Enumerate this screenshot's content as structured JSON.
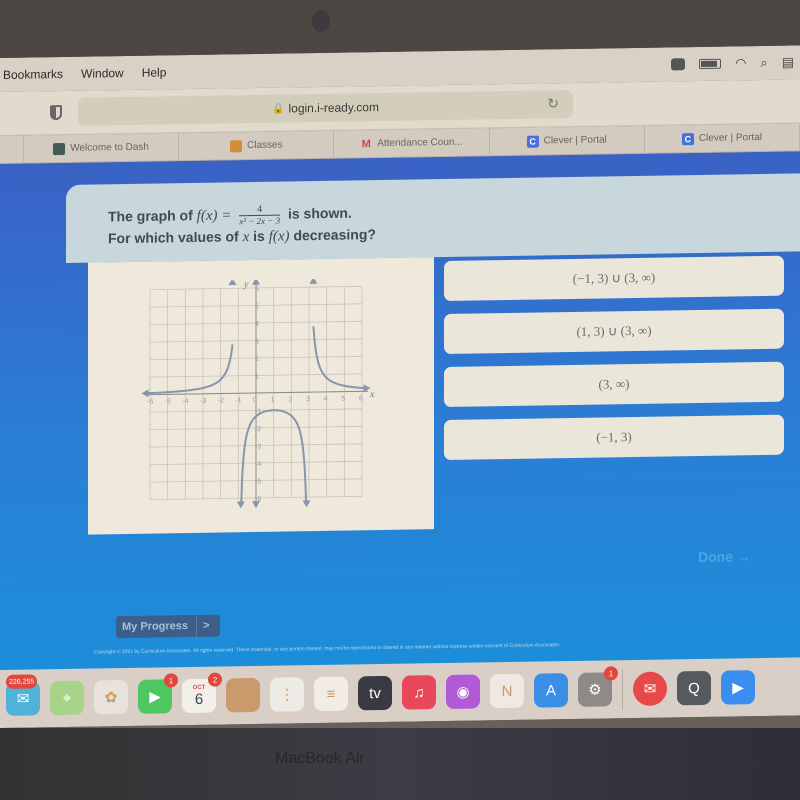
{
  "menubar": {
    "items": [
      "Bookmarks",
      "Window",
      "Help"
    ],
    "status_icons": [
      "camera-icon",
      "battery-icon",
      "wifi-icon",
      "search-icon",
      "control-center-icon"
    ]
  },
  "browser": {
    "url": "login.i-ready.com",
    "tabs": [
      {
        "label": "",
        "icon": "none"
      },
      {
        "label": "Welcome to Dash",
        "icon": "dash-icon"
      },
      {
        "label": "Classes",
        "icon": "classes-icon"
      },
      {
        "label": "Attendance Coun...",
        "icon": "gmail-icon"
      },
      {
        "label": "Clever | Portal",
        "icon": "clever-icon"
      },
      {
        "label": "Clever | Portal",
        "icon": "clever-icon"
      }
    ]
  },
  "question": {
    "prefix": "The graph of ",
    "function_lhs": "f(x) =",
    "numerator": "4",
    "denominator": "x² − 2x − 3",
    "suffix": " is shown.",
    "line2_a": "For which values of ",
    "var_x": "x",
    "line2_b": " is ",
    "fx": "f(x)",
    "line2_c": " decreasing?"
  },
  "answers": [
    "(−1, 3) ∪ (3, ∞)",
    "(1, 3) ∪ (3, ∞)",
    "(3, ∞)",
    "(−1, 3)"
  ],
  "buttons": {
    "done": "Done →",
    "my_progress": "My Progress",
    "my_progress_chevron": ">"
  },
  "footer": {
    "copyright": "Copyright © 2021 by Curriculum Associates. All rights reserved. These materials, or any portion thereof, may not be reproduced or shared in any manner without express written consent of Curriculum Associates."
  },
  "dock": {
    "apps": [
      {
        "name": "mail-app",
        "badge": "226,255",
        "color": "#4fb3d9"
      },
      {
        "name": "maps-app",
        "badge": "",
        "color": "#a8d48a"
      },
      {
        "name": "photos-app",
        "badge": "",
        "color": "#e8e2dc"
      },
      {
        "name": "facetime-app",
        "badge": "1",
        "color": "#4ec761"
      },
      {
        "name": "calendar-app",
        "badge": "2",
        "color": "#f2eee9",
        "month": "OCT",
        "day": "6"
      },
      {
        "name": "contacts-app",
        "badge": "",
        "color": "#c99a6b"
      },
      {
        "name": "reminders-app",
        "badge": "",
        "color": "#eeeae6"
      },
      {
        "name": "notes-app",
        "badge": "",
        "color": "#f2ede4"
      },
      {
        "name": "tv-app",
        "badge": "",
        "color": "#3a3a42",
        "label": "tv"
      },
      {
        "name": "music-app",
        "badge": "",
        "color": "#e8485a"
      },
      {
        "name": "podcasts-app",
        "badge": "",
        "color": "#b15ad6"
      },
      {
        "name": "news-app",
        "badge": "",
        "color": "#efe8e4"
      },
      {
        "name": "app-store-app",
        "badge": "",
        "color": "#3b8ee6"
      },
      {
        "name": "system-preferences-app",
        "badge": "1",
        "color": "#8d8a88"
      },
      {
        "name": "airmail-app",
        "badge": "",
        "color": "#e8484a"
      },
      {
        "name": "quicktime-app",
        "badge": "",
        "color": "#555a5e"
      },
      {
        "name": "zoom-app",
        "badge": "",
        "color": "#3a8ef0"
      }
    ]
  },
  "hardware": {
    "label": "MacBook Air"
  },
  "chart_data": {
    "type": "line",
    "title": "",
    "xlabel": "x",
    "ylabel": "y",
    "xlim": [
      -6,
      6
    ],
    "ylim": [
      -6,
      6
    ],
    "x_ticks": [
      -6,
      -5,
      -4,
      -3,
      -2,
      -1,
      0,
      1,
      2,
      3,
      4,
      5,
      6
    ],
    "y_ticks": [
      -6,
      -5,
      -4,
      -3,
      -2,
      -1,
      1,
      2,
      3,
      4,
      5,
      6
    ],
    "grid": true,
    "function": "4/(x^2-2x-3)",
    "vertical_asymptotes": [
      -1,
      3
    ],
    "series": [
      {
        "name": "left branch",
        "x": [
          -6,
          -5,
          -4,
          -3,
          -2,
          -1.6,
          -1.4,
          -1.3
        ],
        "y": [
          0.0889,
          0.125,
          0.19,
          0.333,
          0.8,
          1.786,
          2.941,
          4.049
        ]
      },
      {
        "name": "middle branch",
        "x": [
          -0.85,
          -0.5,
          0,
          0.5,
          1,
          1.5,
          2,
          2.5,
          2.85
        ],
        "y": [
          -6.84,
          -1.778,
          -1.333,
          -1.067,
          -1,
          -1.067,
          -1.333,
          -1.778,
          -6.84
        ]
      },
      {
        "name": "right branch",
        "x": [
          3.25,
          3.5,
          4,
          5,
          6
        ],
        "y": [
          3.765,
          1.778,
          0.8,
          0.333,
          0.19
        ]
      }
    ]
  }
}
